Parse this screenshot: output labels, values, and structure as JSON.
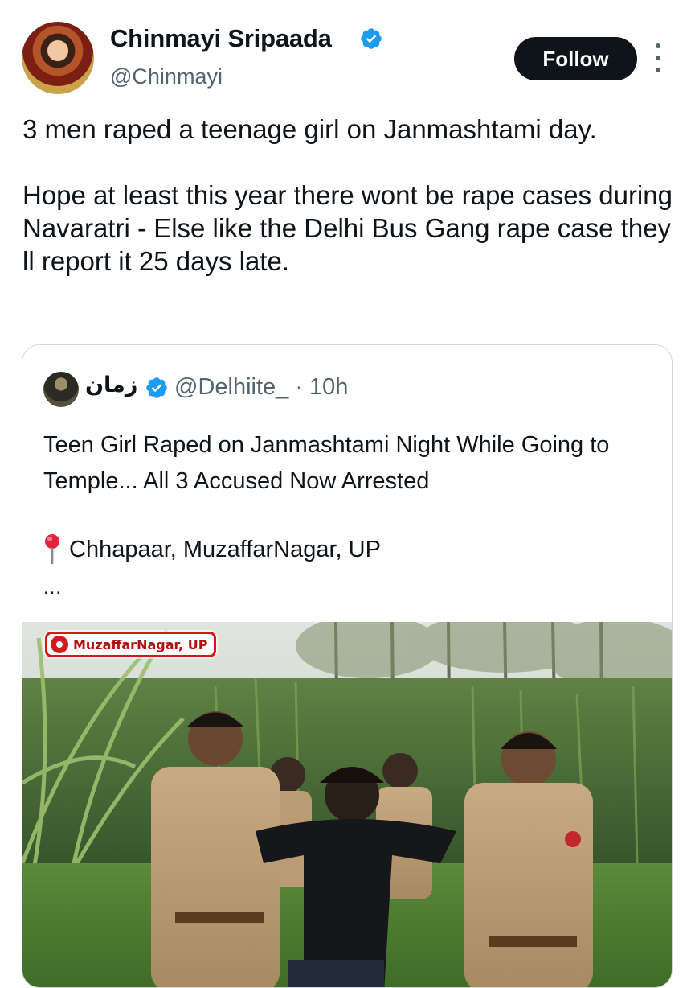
{
  "author": {
    "name": "Chinmayi Sripaada",
    "handle": "@Chinmayi",
    "verified": true,
    "avatar_icon": "profile-photo-icon"
  },
  "actions": {
    "follow_label": "Follow",
    "more_icon": "more-options-icon"
  },
  "tweet": {
    "paragraph_1": "3 men raped a teenage girl on Janmashtami day.",
    "paragraph_2": "Hope at least this year there wont be rape cases during Navaratri - Else like the Delhi Bus Gang rape case they ll report it 25 days late."
  },
  "quoted_tweet": {
    "name": "زمان",
    "handle_time": "@Delhiite_ · 10h",
    "verified": true,
    "headline": "Teen Girl Raped on Janmashtami Night While Going to Temple... All 3 Accused Now Arrested",
    "location": "Chhapaar, MuzaffarNagar, UP",
    "truncated": "...",
    "media": {
      "badge_text": "MuzaffarNagar, UP"
    }
  },
  "colors": {
    "text": "#0f1419",
    "secondary": "#536471",
    "verified_blue": "#1d9bf0",
    "border": "#cfd9de",
    "badge_red": "#d11b1b"
  }
}
